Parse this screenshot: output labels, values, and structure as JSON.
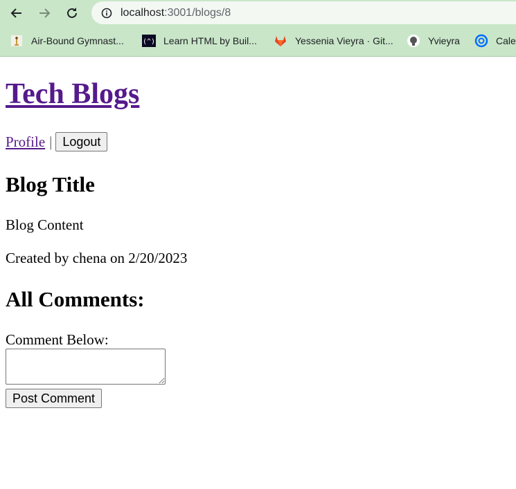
{
  "browser": {
    "url_host": "localhost",
    "url_path": ":3001/blogs/8",
    "bookmarks": [
      {
        "label": "Air-Bound Gymnast...",
        "icon": "gymnast-icon"
      },
      {
        "label": "Learn HTML by Buil...",
        "icon": "freecodecamp-icon"
      },
      {
        "label": "Yessenia Vieyra · Git...",
        "icon": "gitlab-icon"
      },
      {
        "label": "Yvieyra",
        "icon": "github-icon"
      },
      {
        "label": "Cale",
        "icon": "calendly-icon"
      }
    ]
  },
  "site": {
    "title": "Tech Blogs",
    "nav": {
      "profile": "Profile",
      "separator": "|",
      "logout": "Logout"
    }
  },
  "blog": {
    "title": "Blog Title",
    "content": "Blog Content",
    "meta": "Created by chena on 2/20/2023"
  },
  "comments": {
    "heading": "All Comments:",
    "label": "Comment Below:",
    "input_value": "",
    "submit_label": "Post Comment"
  },
  "colors": {
    "chrome_bg": "#c9e6c9",
    "visited_link": "#551a8b"
  }
}
